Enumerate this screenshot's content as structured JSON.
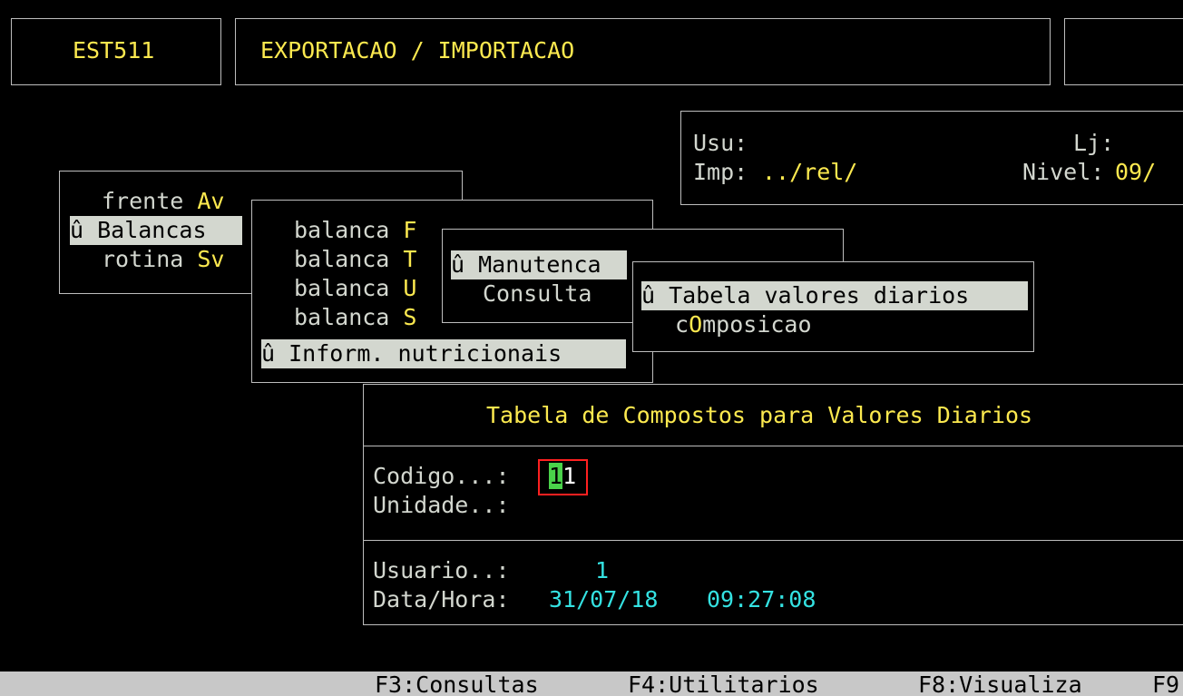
{
  "header": {
    "code": "EST511",
    "title": "EXPORTACAO / IMPORTACAO"
  },
  "user_panel": {
    "usu_label": "Usu:",
    "lj_label": "Lj:",
    "imp_label": "Imp:",
    "imp_value": "../rel/",
    "nivel_label": "Nivel:",
    "nivel_value": "09/"
  },
  "menu1": {
    "items": [
      {
        "text": "frente ",
        "hot": "Av"
      },
      {
        "text": "û Balancas"
      },
      {
        "text": "rotina ",
        "hot": "Sv"
      }
    ]
  },
  "menu2": {
    "items": [
      {
        "text": "balanca ",
        "hot": "F"
      },
      {
        "text": "balanca ",
        "hot": "T"
      },
      {
        "text": "balanca ",
        "hot": "U"
      },
      {
        "text": "balanca ",
        "hot": "S"
      },
      {
        "text": "û Inform. nutricionais"
      }
    ]
  },
  "menu3": {
    "items": [
      {
        "text": "û Manutenca"
      },
      {
        "text": "Consulta"
      }
    ]
  },
  "menu4": {
    "items": [
      {
        "text": "û Tabela valores diarios"
      },
      {
        "pre": "c",
        "hot": "O",
        "post": "mposicao"
      }
    ]
  },
  "form": {
    "title": "Tabela de Compostos para Valores Diarios",
    "codigo_label": "Codigo...:",
    "codigo_cursor": "1",
    "codigo_rest": "1",
    "unidade_label": "Unidade..:",
    "usuario_label": "Usuario..:",
    "usuario_value": "1",
    "datahora_label": "Data/Hora:",
    "date": "31/07/18",
    "time": "09:27:08"
  },
  "statusbar": {
    "f3": "F3:Consultas",
    "f4": "F4:Utilitarios",
    "f8": "F8:Visualiza",
    "f9": "F9"
  }
}
